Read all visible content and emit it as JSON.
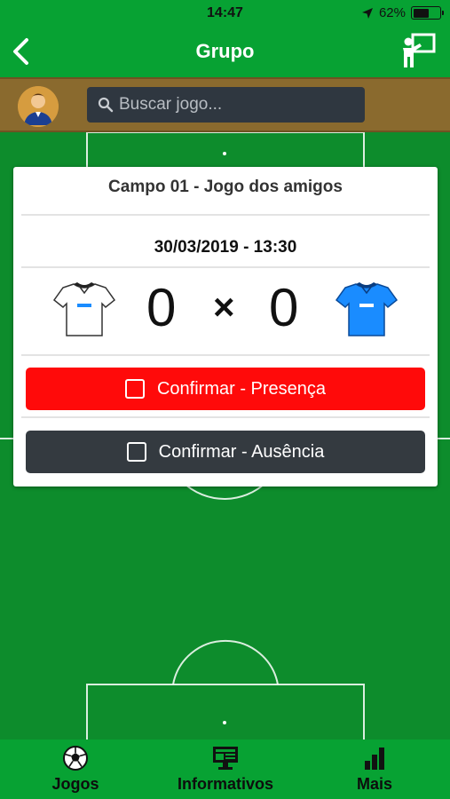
{
  "status": {
    "time": "14:47",
    "battery": "62%",
    "battery_level": 0.62
  },
  "nav": {
    "title": "Grupo",
    "back_icon": "chevron-left-icon",
    "right_icon": "presentation-board-icon"
  },
  "search": {
    "placeholder": "Buscar jogo...",
    "value": ""
  },
  "match": {
    "title": "Campo 01 - Jogo dos amigos",
    "datetime": "30/03/2019 - 13:30",
    "home_score": "0",
    "separator": "×",
    "away_score": "0",
    "home_shirt_color": "#ffffff",
    "away_shirt_color": "#1a8cff"
  },
  "actions": {
    "confirm_presence": "Confirmar - Presença",
    "confirm_absence": "Confirmar - Ausência"
  },
  "tabs": [
    {
      "label": "Jogos",
      "icon": "soccer-ball-icon",
      "active": true
    },
    {
      "label": "Informativos",
      "icon": "monitor-icon",
      "active": false
    },
    {
      "label": "Mais",
      "icon": "bar-chart-icon",
      "active": false
    }
  ],
  "colors": {
    "primary_green": "#07a233",
    "field_green": "#0d8c2c",
    "search_band": "#8a6a2e",
    "presence_red": "#ff0a0a",
    "absence_dark": "#343a40"
  }
}
